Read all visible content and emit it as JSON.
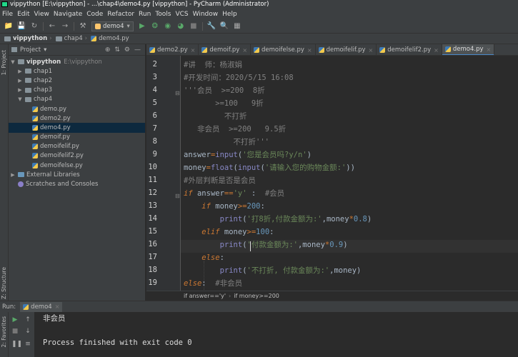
{
  "window": {
    "title": "vippython [E:\\vippython] - ...\\chap4\\demo4.py [vippython] - PyCharm (Administrator)"
  },
  "menu": [
    "File",
    "Edit",
    "View",
    "Navigate",
    "Code",
    "Refactor",
    "Run",
    "Tools",
    "VCS",
    "Window",
    "Help"
  ],
  "toolbar": {
    "run_config": "demo4",
    "icons": [
      "open-icon",
      "save-icon",
      "sync-icon",
      "back-icon",
      "forward-icon",
      "build-icon",
      "run-icon",
      "debug-icon",
      "coverage-icon",
      "profile-icon",
      "stop-icon",
      "settings-icon",
      "search-icon",
      "vcs-icon"
    ]
  },
  "breadcrumb": [
    "vippython",
    "chap4",
    "demo4.py"
  ],
  "project_panel": {
    "title": "Project",
    "root": {
      "name": "vippython",
      "path": "E:\\vippython"
    },
    "folders": [
      "chap1",
      "chap2",
      "chap3",
      "chap4"
    ],
    "files": [
      "demo.py",
      "demo2.py",
      "demo4.py",
      "demoif.py",
      "demoifelif.py",
      "demoifelif2.py",
      "demoifelse.py"
    ],
    "selected_file": "demo4.py",
    "external": "External Libraries",
    "scratches": "Scratches and Consoles"
  },
  "side_labels": {
    "project": "1: Project",
    "structure": "Z: Structure",
    "favorites": "2: Favorites"
  },
  "tabs": [
    {
      "label": "demo2.py",
      "active": false
    },
    {
      "label": "demoif.py",
      "active": false
    },
    {
      "label": "demoifelse.py",
      "active": false
    },
    {
      "label": "demoifelif.py",
      "active": false
    },
    {
      "label": "demoifelif2.py",
      "active": false
    },
    {
      "label": "demo4.py",
      "active": true
    }
  ],
  "editor": {
    "line_numbers": [
      "2",
      "3",
      "4",
      "5",
      "6",
      "7",
      "8",
      "9",
      "10",
      "11",
      "12",
      "13",
      "14",
      "15",
      "16",
      "17",
      "18",
      "19"
    ],
    "current_line": "16",
    "code_crumb": [
      "if answer=='y'",
      "if money>=200"
    ],
    "lines": {
      "l2": "#讲  师：杨淑娟",
      "l3": "#开发时间：2020/5/15 16:08",
      "l4a": "'''会员  >=200  8折",
      "l5": "       >=100   9折",
      "l6": "         不打折",
      "l7": "   非会员  >=200   9.5折",
      "l8": "           不打折'''",
      "l9a": "answer",
      "l9b": "=",
      "l9c": "input",
      "l9d": "(",
      "l9e": "'您是会员吗?y/n'",
      "l9f": ")",
      "l10a": "money",
      "l10b": "=",
      "l10c": "float",
      "l10d": "(",
      "l10e": "input",
      "l10f": "(",
      "l10g": "'请输入您的购物金额:'",
      "l10h": "))",
      "l11": "#外层判断是否是会员",
      "l12a": "if",
      "l12b": " answer",
      "l12c": "==",
      "l12d": "'y'",
      "l12e": " :  ",
      "l12f": "#会员",
      "l13a": "    if",
      "l13b": " money",
      "l13c": ">=",
      "l13d": "200",
      "l13e": ":",
      "l14a": "        print",
      "l14b": "(",
      "l14c": "'打8折,付款金额为:'",
      "l14d": ",money",
      "l14e": "*",
      "l14f": "0.8",
      "l14g": ")",
      "l15a": "    elif",
      "l15b": " money",
      "l15c": ">=",
      "l15d": "100",
      "l15e": ":",
      "l16a": "        print",
      "l16b": "(",
      "l16c": "'付款金额为:'",
      "l16d": ",money",
      "l16e": "*",
      "l16f": "0.9",
      "l16g": ")",
      "l17a": "    else",
      "l17b": ":",
      "l18a": "        print",
      "l18b": "(",
      "l18c": "'不打折, 付款金额为:'",
      "l18d": ",money)",
      "l19a": "else",
      "l19b": ":  ",
      "l19c": "#非会员"
    }
  },
  "run_panel": {
    "label": "Run:",
    "tab": "demo4",
    "output": [
      "非会员",
      "",
      "Process finished with exit code 0"
    ]
  },
  "colors": {
    "background": "#2b2b2b",
    "panel": "#3c3f41",
    "keyword": "#cc7832",
    "string": "#6a8759",
    "number": "#6897bb",
    "comment": "#808080",
    "builtin": "#8888c6",
    "selection": "#0d293e"
  }
}
